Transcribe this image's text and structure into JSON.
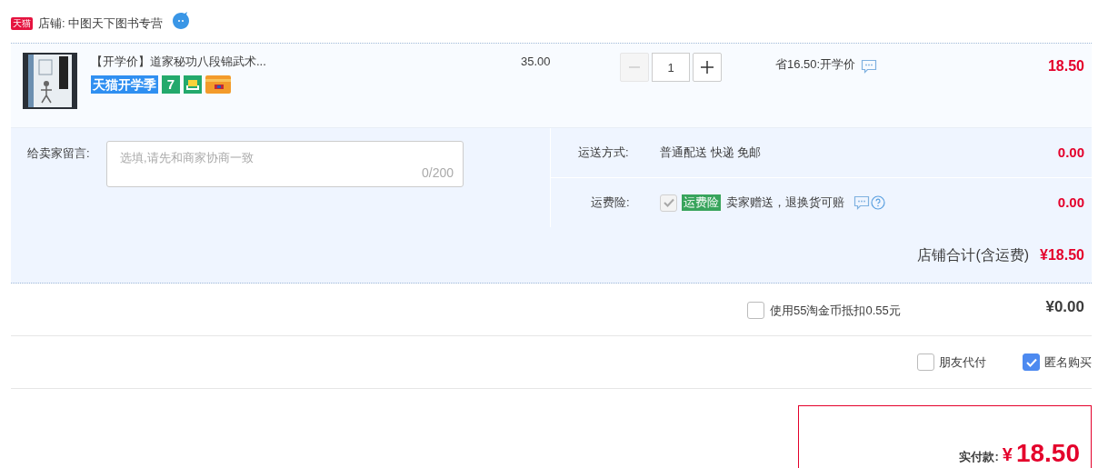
{
  "shop": {
    "badge": "天猫",
    "name": "店铺: 中图天下图书专营"
  },
  "item": {
    "title": "【开学价】道家秘功八段锦武术...",
    "promo_badge": "天猫开学季",
    "service_badges": [
      {
        "kind": "text",
        "label": "7"
      },
      {
        "kind": "bag"
      },
      {
        "kind": "card"
      }
    ],
    "price": "35.00",
    "quantity": "1",
    "minus_disabled": true,
    "saving": "省16.50:开学价",
    "subtotal": "18.50"
  },
  "message": {
    "label": "给卖家留言:",
    "placeholder": "选填,请先和商家协商一致",
    "counter": "0/200"
  },
  "shipping": {
    "label": "运送方式:",
    "value": "普通配送 快递 免邮",
    "amount": "0.00"
  },
  "insurance": {
    "label": "运费险:",
    "checked": true,
    "disabled": true,
    "tag": "运费险",
    "text": "卖家赠送，退换货可赔",
    "amount": "0.00"
  },
  "shop_total": {
    "label": "店铺合计(含运费)",
    "amount": "¥18.50"
  },
  "coins": {
    "label": "使用55淘金币抵扣0.55元",
    "checked": false,
    "amount": "¥0.00"
  },
  "options": [
    {
      "label": "朋友代付",
      "checked": false
    },
    {
      "label": "匿名购买",
      "checked": true
    }
  ],
  "payment": {
    "label": "实付款:",
    "currency": "¥",
    "amount": "18.50"
  }
}
